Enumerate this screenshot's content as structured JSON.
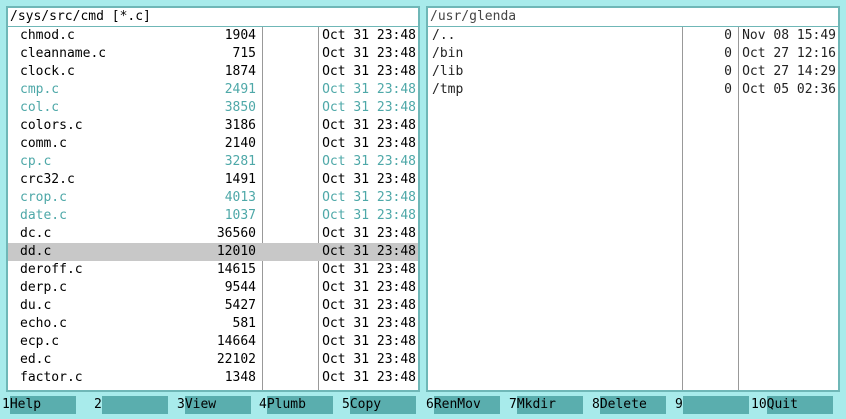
{
  "left_panel": {
    "path": "/sys/src/cmd [*.c]",
    "files": [
      {
        "name": "chmod.c",
        "size": "1904",
        "date": "Oct 31 23:48",
        "style": "normal"
      },
      {
        "name": "cleanname.c",
        "size": "715",
        "date": "Oct 31 23:48",
        "style": "normal"
      },
      {
        "name": "clock.c",
        "size": "1874",
        "date": "Oct 31 23:48",
        "style": "normal"
      },
      {
        "name": "cmp.c",
        "size": "2491",
        "date": "Oct 31 23:48",
        "style": "dim"
      },
      {
        "name": "col.c",
        "size": "3850",
        "date": "Oct 31 23:48",
        "style": "dim"
      },
      {
        "name": "colors.c",
        "size": "3186",
        "date": "Oct 31 23:48",
        "style": "normal"
      },
      {
        "name": "comm.c",
        "size": "2140",
        "date": "Oct 31 23:48",
        "style": "normal"
      },
      {
        "name": "cp.c",
        "size": "3281",
        "date": "Oct 31 23:48",
        "style": "dim"
      },
      {
        "name": "crc32.c",
        "size": "1491",
        "date": "Oct 31 23:48",
        "style": "normal"
      },
      {
        "name": "crop.c",
        "size": "4013",
        "date": "Oct 31 23:48",
        "style": "dim"
      },
      {
        "name": "date.c",
        "size": "1037",
        "date": "Oct 31 23:48",
        "style": "dim"
      },
      {
        "name": "dc.c",
        "size": "36560",
        "date": "Oct 31 23:48",
        "style": "normal"
      },
      {
        "name": "dd.c",
        "size": "12010",
        "date": "Oct 31 23:48",
        "style": "selected"
      },
      {
        "name": "deroff.c",
        "size": "14615",
        "date": "Oct 31 23:48",
        "style": "normal"
      },
      {
        "name": "derp.c",
        "size": "9544",
        "date": "Oct 31 23:48",
        "style": "normal"
      },
      {
        "name": "du.c",
        "size": "5427",
        "date": "Oct 31 23:48",
        "style": "normal"
      },
      {
        "name": "echo.c",
        "size": "581",
        "date": "Oct 31 23:48",
        "style": "normal"
      },
      {
        "name": "ecp.c",
        "size": "14664",
        "date": "Oct 31 23:48",
        "style": "normal"
      },
      {
        "name": "ed.c",
        "size": "22102",
        "date": "Oct 31 23:48",
        "style": "normal"
      },
      {
        "name": "factor.c",
        "size": "1348",
        "date": "Oct 31 23:48",
        "style": "normal"
      }
    ]
  },
  "right_panel": {
    "path": "/usr/glenda",
    "files": [
      {
        "name": "/..",
        "size": "0",
        "date": "Nov 08 15:49",
        "style": "dir"
      },
      {
        "name": "/bin",
        "size": "0",
        "date": "Oct 27 12:16",
        "style": "dir"
      },
      {
        "name": "/lib",
        "size": "0",
        "date": "Oct 27 14:29",
        "style": "dir"
      },
      {
        "name": "/tmp",
        "size": "0",
        "date": "Oct 05 02:36",
        "style": "dir"
      }
    ]
  },
  "function_keys": [
    {
      "num": "1",
      "label": "Help"
    },
    {
      "num": "2",
      "label": ""
    },
    {
      "num": "3",
      "label": "View"
    },
    {
      "num": "4",
      "label": "Plumb"
    },
    {
      "num": "5",
      "label": "Copy"
    },
    {
      "num": "6",
      "label": "RenMov"
    },
    {
      "num": "7",
      "label": "Mkdir"
    },
    {
      "num": "8",
      "label": "Delete"
    },
    {
      "num": "9",
      "label": ""
    },
    {
      "num": "10",
      "label": "Quit"
    }
  ],
  "colors": {
    "background": "#a8ebeb",
    "panel_border": "#6fb7b7",
    "dim_text": "#4ea8a8",
    "selection": "#c8c8c8",
    "fkey_label_bg": "#5aaeae"
  }
}
